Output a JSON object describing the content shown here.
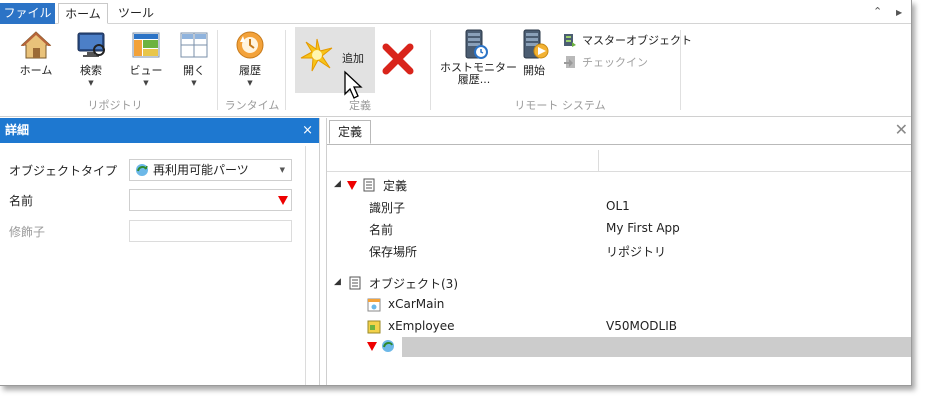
{
  "tabs": {
    "file": "ファイル",
    "home": "ホーム",
    "tools": "ツール"
  },
  "ribbon": {
    "groups": {
      "repository": "リポジトリ",
      "runtime": "ランタイム",
      "definition": "定義",
      "remote": "リモート システム"
    },
    "buttons": {
      "home": "ホーム",
      "search": "検索",
      "view": "ビュー",
      "open": "開く",
      "history": "履歴",
      "add": "追加",
      "host_monitor_line1": "ホストモニター",
      "host_monitor_line2": "履歴...",
      "start": "開始",
      "master_object": "マスターオブジェクト",
      "check_in": "チェックイン"
    }
  },
  "details": {
    "title": "詳細",
    "close": "×",
    "object_type_label": "オブジェクトタイプ",
    "object_type_value": "再利用可能パーツ",
    "name_label": "名前",
    "modifier_label": "修飾子"
  },
  "right": {
    "tab": "定義",
    "close": "✕",
    "definition_group": "定義",
    "rows": [
      {
        "label": "識別子",
        "value": "OL1"
      },
      {
        "label": "名前",
        "value": "My First App"
      },
      {
        "label": "保存場所",
        "value": "リポジトリ"
      }
    ],
    "objects_group": "オブジェクト(3)",
    "objects": [
      {
        "name": "xCarMain",
        "value": ""
      },
      {
        "name": "xEmployee",
        "value": "V50MODLIB"
      }
    ]
  },
  "colors": {
    "file_tab": "#2b73c6",
    "detail_header": "#1e78d0",
    "required_marker": "#e00000",
    "add_icon": "#f5c400",
    "delete_icon": "#d9241b"
  }
}
